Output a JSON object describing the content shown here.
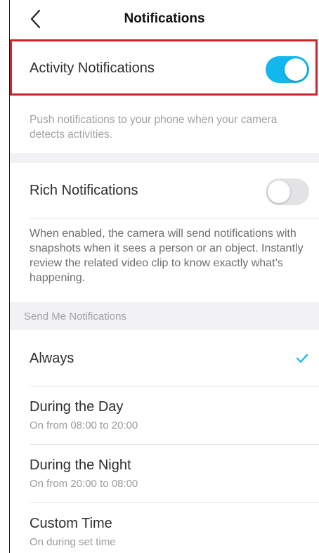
{
  "header": {
    "title": "Notifications"
  },
  "activity": {
    "label": "Activity Notifications",
    "enabled": true,
    "description": "Push notifications to your phone when your camera detects activities."
  },
  "rich": {
    "label": "Rich Notifications",
    "enabled": false,
    "description": "When enabled, the camera will send notifications with snapshots when it sees a person or an object. Instantly review the related video clip to know exactly what’s happening."
  },
  "send_section": {
    "label": "Send Me Notifications",
    "options": [
      {
        "title": "Always",
        "subtitle": "",
        "selected": true
      },
      {
        "title": "During the Day",
        "subtitle": "On from 08:00 to 20:00",
        "selected": false
      },
      {
        "title": "During the Night",
        "subtitle": "On from 20:00 to 08:00",
        "selected": false
      },
      {
        "title": "Custom Time",
        "subtitle": "On during set time",
        "selected": false
      }
    ]
  },
  "colors": {
    "accent": "#11b7ed",
    "highlight_border": "#d0232a",
    "toggle_off": "#e3e3e6",
    "section_bg": "#f2f2f4"
  },
  "icons": {
    "back": "chevron-left-icon",
    "selected": "checkmark-icon"
  }
}
